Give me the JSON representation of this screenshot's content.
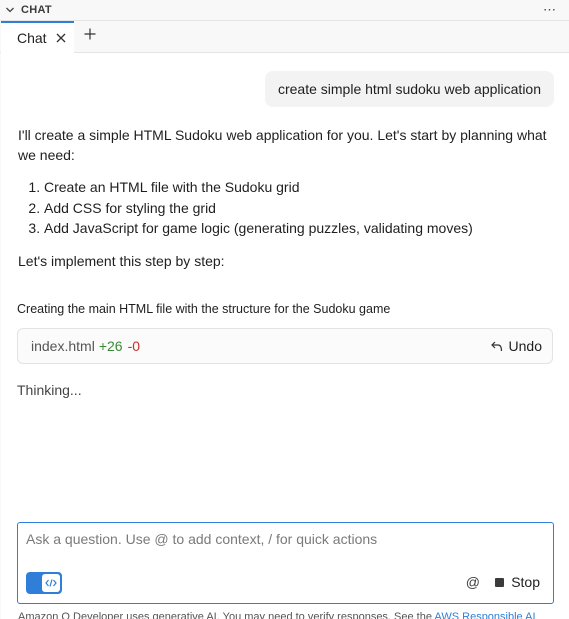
{
  "panel": {
    "title": "CHAT",
    "more_icon": "more-icon"
  },
  "tabs": [
    {
      "label": "Chat",
      "active": true
    }
  ],
  "conversation": {
    "user_message": "create simple html sudoku web application",
    "assistant": {
      "intro": "I'll create a simple HTML Sudoku web application for you. Let's start by planning what we need:",
      "steps": [
        "Create an HTML file with the Sudoku grid",
        "Add CSS for styling the grid",
        "Add JavaScript for game logic (generating puzzles, validating moves)"
      ],
      "outro": "Let's implement this step by step:",
      "action_description": "Creating the main HTML file with the structure for the Sudoku game",
      "file_change": {
        "filename": "index.html",
        "additions": "+26",
        "deletions": "-0",
        "undo_label": "Undo"
      },
      "status": "Thinking..."
    }
  },
  "input": {
    "placeholder": "Ask a question. Use @ to add context, / for quick actions",
    "value": "",
    "at_label": "@",
    "stop_label": "Stop"
  },
  "footer": {
    "disclaimer": "Amazon Q Developer uses generative AI. You may need to verify responses. See the ",
    "link_label": "AWS Responsible AI"
  },
  "colors": {
    "accent": "#2f7fd9",
    "additions": "#388a34",
    "deletions": "#c72e2e"
  }
}
